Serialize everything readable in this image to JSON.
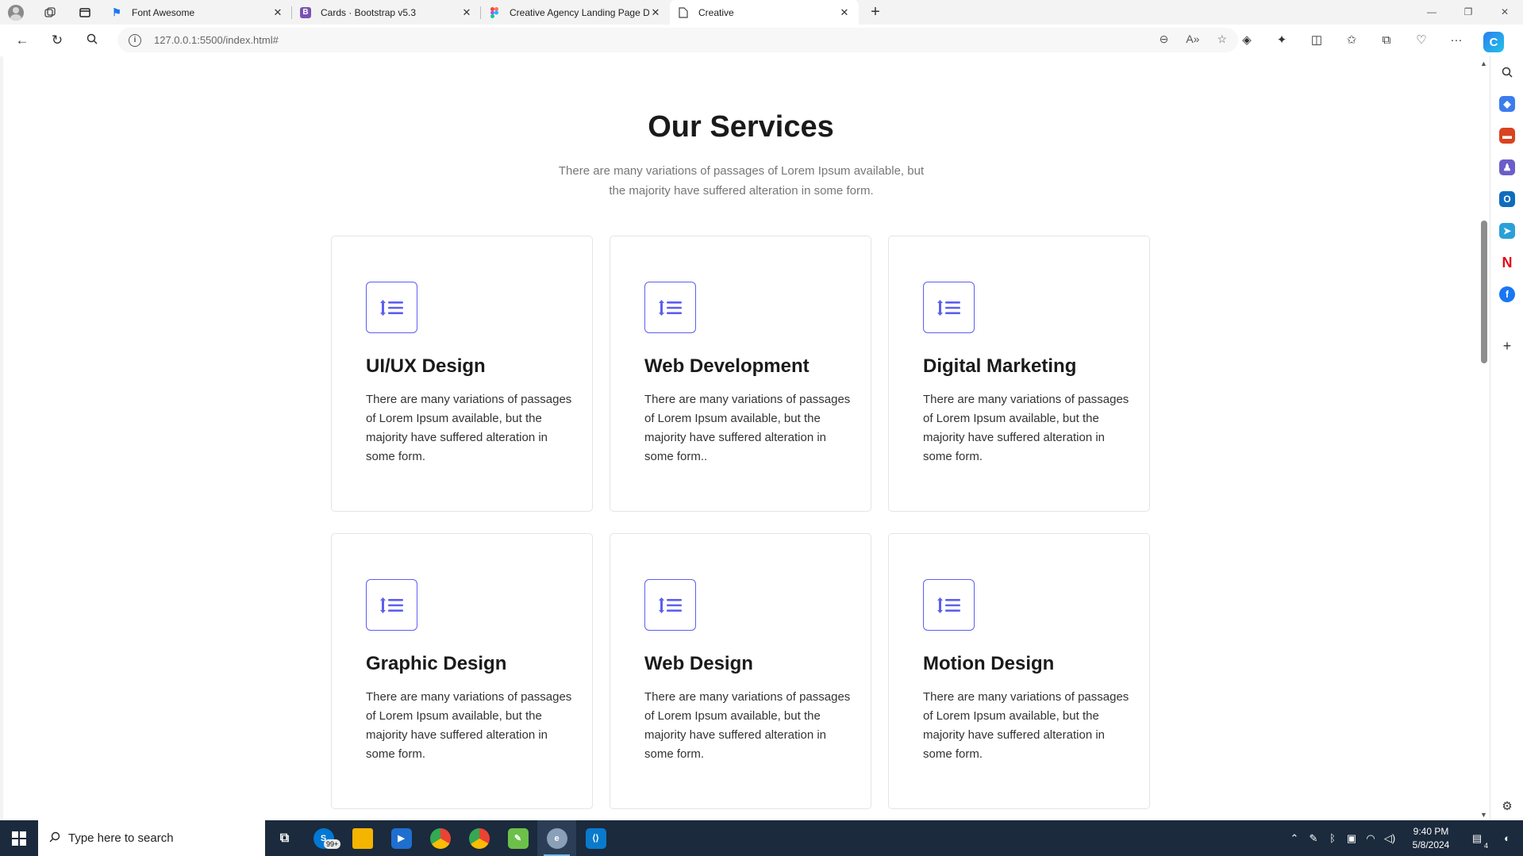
{
  "browser": {
    "tabs": [
      {
        "title": "Font Awesome",
        "favicon_color": "#1877f2",
        "favicon_glyph": "⚑"
      },
      {
        "title": "Cards · Bootstrap v5.3",
        "favicon_color": "#7952b3",
        "favicon_glyph": "B"
      },
      {
        "title": "Creative Agency Landing Page De",
        "favicon_color": "#f24e1e",
        "favicon_glyph": "F"
      },
      {
        "title": "Creative",
        "favicon_color": "#ffffff",
        "favicon_glyph": ""
      }
    ],
    "active_tab": 3,
    "url_host": "127.0.0.1",
    "url_rest": ":5500/index.html#"
  },
  "services": {
    "title": "Our Services",
    "subtitle": "There are many variations of passages of Lorem Ipsum available, but the majority have suffered alteration in some form.",
    "cards": [
      {
        "title": "UI/UX Design",
        "text": "There are many variations of passages of Lorem Ipsum available, but the majority have suffered alteration in some form."
      },
      {
        "title": "Web Development",
        "text": "There are many variations of passages of Lorem Ipsum available, but the majority have suffered alteration in some form.."
      },
      {
        "title": "Digital Marketing",
        "text": "There are many variations of passages of Lorem Ipsum available, but the majority have suffered alteration in some form."
      },
      {
        "title": "Graphic Design",
        "text": "There are many variations of passages of Lorem Ipsum available, but the majority have suffered alteration in some form."
      },
      {
        "title": "Web Design",
        "text": "There are many variations of passages of Lorem Ipsum available, but the majority have suffered alteration in some form."
      },
      {
        "title": "Motion Design",
        "text": "There are many variations of passages of Lorem Ipsum available, but the majority have suffered alteration in some form."
      }
    ],
    "accent_color": "#5d5fef",
    "icon": "list-sort-icon"
  },
  "taskbar": {
    "search_placeholder": "Type here to search",
    "badge": "99+",
    "time": "9:40 PM",
    "date": "5/8/2024",
    "notifications": "4"
  }
}
